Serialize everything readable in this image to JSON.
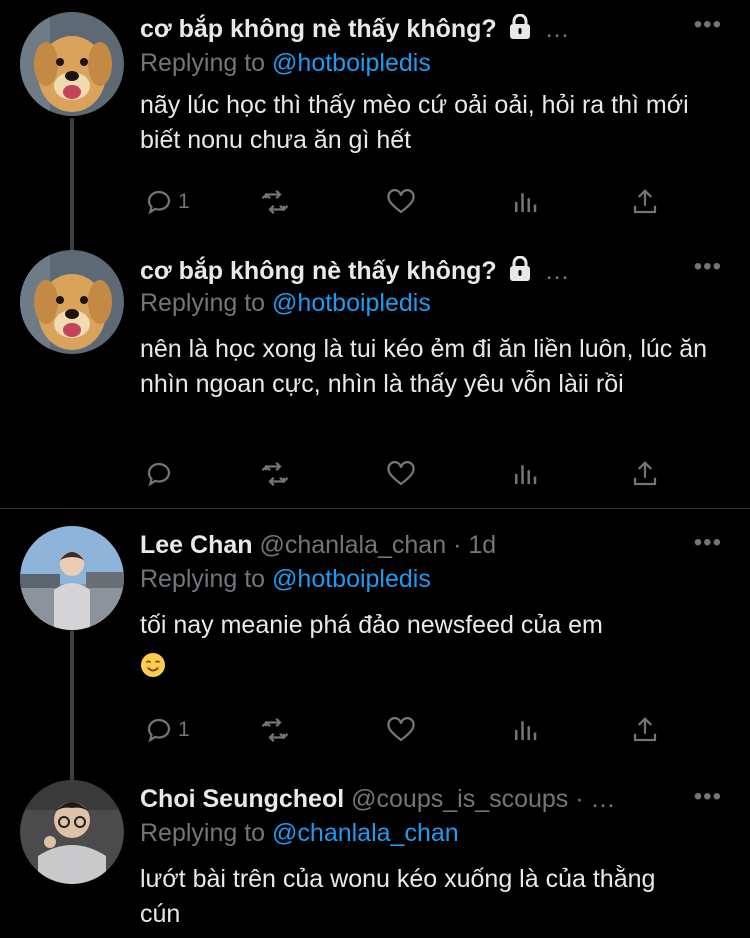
{
  "tweets": [
    {
      "name": "cơ bắp không nè thấy không?",
      "locked": true,
      "truncated": "…",
      "reply_prefix": "Replying to",
      "reply_to": "@hotboipledis",
      "text": "nãy lúc học thì thấy mèo cứ oải oải, hỏi ra thì mới biết nonu chưa ăn gì hết",
      "reply_count": "1",
      "avatar": "golden-retriever-puppy"
    },
    {
      "name": "cơ bắp không nè thấy không?",
      "locked": true,
      "truncated": "…",
      "reply_prefix": "Replying to",
      "reply_to": "@hotboipledis",
      "text": "nên là học xong là tui kéo ẻm đi ăn liền luôn, lúc ăn nhìn ngoan cực, nhìn là thấy yêu vỗn làii rồi",
      "reply_count": "",
      "avatar": "golden-retriever-puppy"
    },
    {
      "name": "Lee Chan",
      "handle": "@chanlala_chan",
      "time": "· 1d",
      "reply_prefix": "Replying to",
      "reply_to": "@hotboipledis",
      "text": "tối nay meanie phá đảo newsfeed của em",
      "emoji": "smiling-face",
      "reply_count": "1",
      "avatar": "person-outdoor"
    },
    {
      "name": "Choi Seungcheol",
      "handle": "@coups_is_scoups",
      "time": "· …",
      "reply_prefix": "Replying to",
      "reply_to": "@chanlala_chan",
      "text": "lướt bài trên của wonu kéo xuống là của thằng cún",
      "avatar": "person-selfie"
    }
  ],
  "more_label": "•••",
  "colors": {
    "background": "#000000",
    "text": "#e7e9ea",
    "muted": "#71767b",
    "link": "#1d9bf0",
    "thread": "#3a3d42"
  }
}
